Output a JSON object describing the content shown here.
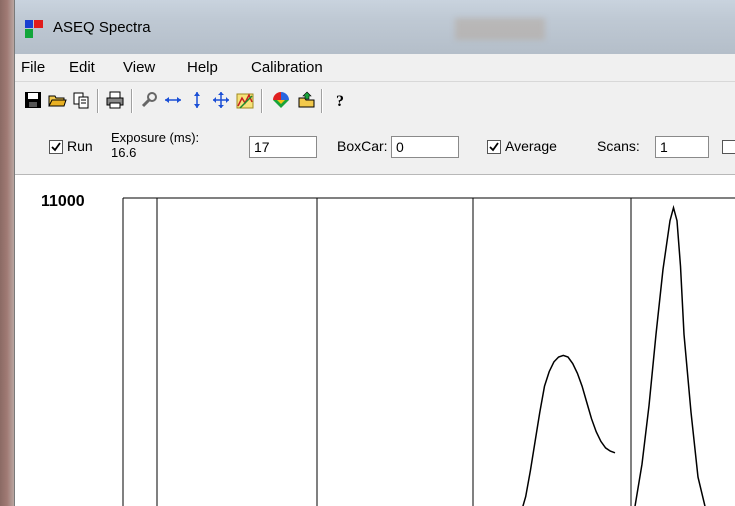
{
  "window": {
    "title": "ASEQ Spectra"
  },
  "menu": {
    "items": [
      "File",
      "Edit",
      "View",
      "Help",
      "Calibration"
    ]
  },
  "toolbar": {
    "icons": [
      "save-icon",
      "open-folder-icon",
      "copy-icon",
      "print-icon",
      "wrench-icon",
      "zoom-horizontal-icon",
      "zoom-vertical-icon",
      "pan-icon",
      "autoscale-icon",
      "color-picker-icon",
      "folder-open-icon",
      "help-icon"
    ]
  },
  "controls": {
    "run_label": "Run",
    "run_checked": true,
    "exposure_label": "Exposure (ms):",
    "exposure_readout": "16.6",
    "exposure_value": "17",
    "boxcar_label": "BoxCar:",
    "boxcar_value": "0",
    "average_label": "Average",
    "average_checked": true,
    "scans_label": "Scans:",
    "scans_value": "1"
  },
  "chart_data": {
    "type": "line",
    "y_tick_labels": [
      "11000"
    ],
    "ylim": [
      0,
      11000
    ],
    "grid": true,
    "series": [
      {
        "x": [
          0.0,
          0.05,
          0.1,
          0.15,
          0.2,
          0.25,
          0.3,
          0.35,
          0.4,
          0.45,
          0.5,
          0.55,
          0.6,
          0.65,
          0.7,
          0.75,
          0.8,
          0.85,
          0.9,
          0.95,
          1.0
        ],
        "values": [
          1300,
          1800,
          2600,
          3500,
          4400,
          5200,
          5650,
          5950,
          6100,
          6150,
          6100,
          5900,
          5600,
          5200,
          4700,
          4200,
          3800,
          3500,
          3300,
          3200,
          3150
        ]
      },
      {
        "x": [
          0.0,
          0.1,
          0.2,
          0.3,
          0.4,
          0.5,
          0.55,
          0.6,
          0.65,
          0.7,
          0.8,
          0.9,
          1.0
        ],
        "values": [
          1500,
          2800,
          4600,
          6800,
          8800,
          10300,
          10700,
          10300,
          8900,
          6800,
          4400,
          2400,
          1500
        ]
      }
    ]
  }
}
